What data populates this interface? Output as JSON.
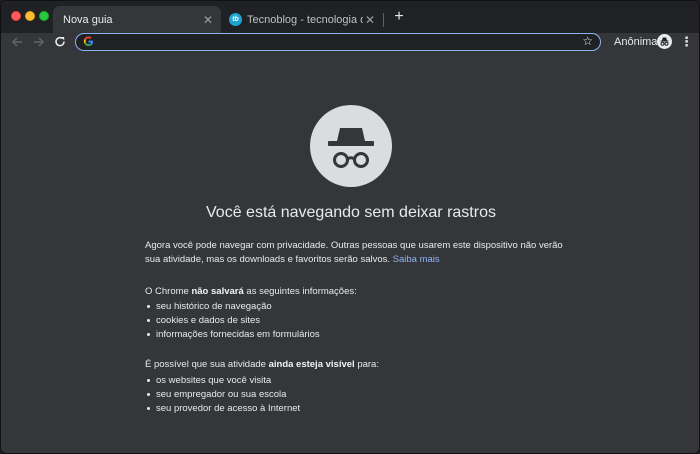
{
  "tabs": [
    {
      "title": "Nova guia",
      "active": true
    },
    {
      "title": "Tecnoblog - tecnologia que interessa",
      "active": false,
      "favicon_text": "tb"
    }
  ],
  "new_tab_symbol": "+",
  "omnibox": {
    "value": "",
    "placeholder": ""
  },
  "profile": {
    "label": "Anônima"
  },
  "incognito": {
    "heading": "Você está navegando sem deixar rastros",
    "intro": "Agora você pode navegar com privacidade. Outras pessoas que usarem este dispositivo não verão sua atividade, mas os downloads e favoritos serão salvos.",
    "learn_more": "Saiba mais",
    "not_saved_prefix": "O Chrome ",
    "not_saved_strong": "não salvará",
    "not_saved_suffix": " as seguintes informações:",
    "not_saved_items": [
      "seu histórico de navegação",
      "cookies e dados de sites",
      "informações fornecidas em formulários"
    ],
    "visible_prefix": "É possível que sua atividade ",
    "visible_strong": "ainda esteja visível",
    "visible_suffix": " para:",
    "visible_items": [
      "os websites que você visita",
      "seu empregador ou sua escola",
      "seu provedor de acesso à Internet"
    ]
  },
  "colors": {
    "background": "#35363a",
    "tabstrip": "#202124",
    "link": "#8ab4f8",
    "icon_circle": "#dadce0"
  },
  "icons": [
    "back-arrow",
    "forward-arrow",
    "reload",
    "google-g",
    "star",
    "incognito",
    "three-dots-menu",
    "close"
  ]
}
